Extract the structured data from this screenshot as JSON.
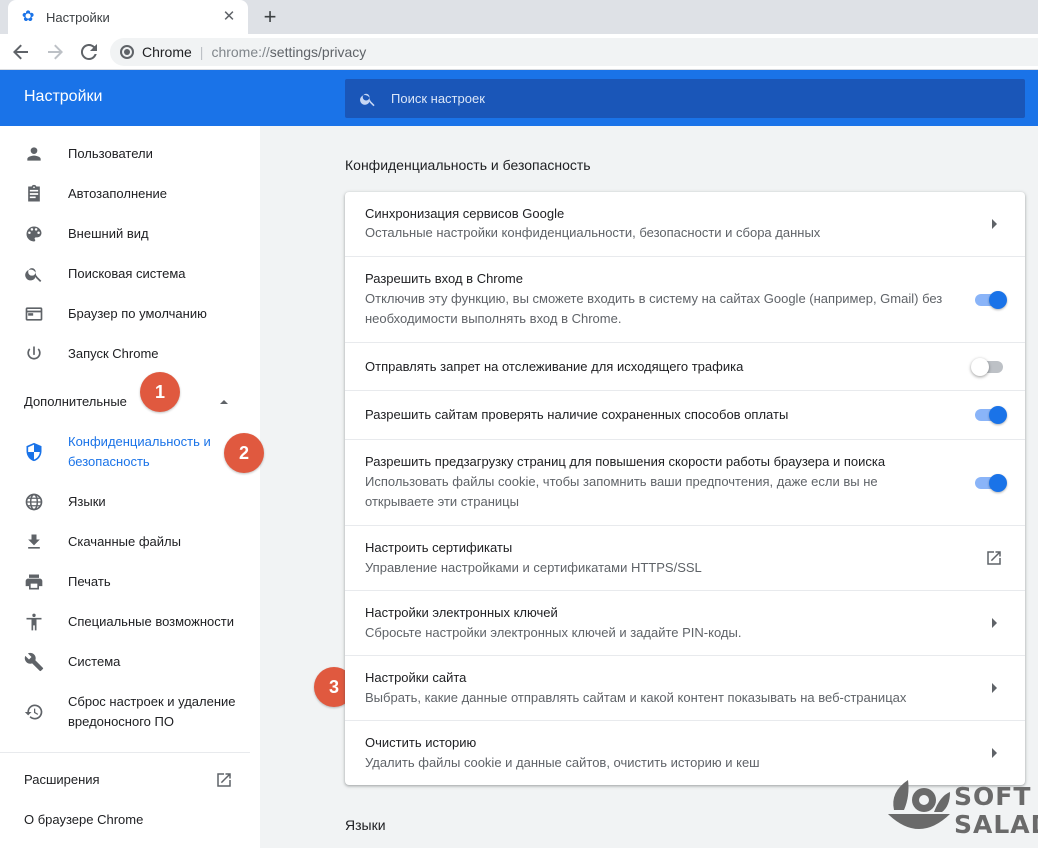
{
  "browser": {
    "tab_title": "Настройки",
    "address_origin": "Chrome",
    "address_scheme": "chrome://",
    "address_rest": "settings/privacy"
  },
  "header": {
    "title": "Настройки",
    "search_placeholder": "Поиск настроек"
  },
  "sidebar": {
    "items": [
      {
        "label": "Пользователи",
        "icon": "person-icon"
      },
      {
        "label": "Автозаполнение",
        "icon": "clipboard-icon"
      },
      {
        "label": "Внешний вид",
        "icon": "palette-icon"
      },
      {
        "label": "Поисковая система",
        "icon": "search-icon"
      },
      {
        "label": "Браузер по умолчанию",
        "icon": "browser-window-icon"
      },
      {
        "label": "Запуск Chrome",
        "icon": "power-icon"
      }
    ],
    "advanced_label": "Дополнительные",
    "advanced_items": [
      {
        "label": "Конфиденциальность и безопасность",
        "icon": "shield-icon",
        "active": true
      },
      {
        "label": "Языки",
        "icon": "globe-icon"
      },
      {
        "label": "Скачанные файлы",
        "icon": "download-icon"
      },
      {
        "label": "Печать",
        "icon": "printer-icon"
      },
      {
        "label": "Специальные возможности",
        "icon": "accessibility-icon"
      },
      {
        "label": "Система",
        "icon": "wrench-icon"
      },
      {
        "label": "Сброс настроек и удаление вредоносного ПО",
        "icon": "restore-icon"
      }
    ],
    "extensions_label": "Расширения",
    "about_label": "О браузере Chrome"
  },
  "badges": [
    "1",
    "2",
    "3"
  ],
  "main": {
    "section_title": "Конфиденциальность и безопасность",
    "next_section_title": "Языки",
    "rows": [
      {
        "title": "Синхронизация сервисов Google",
        "subtitle": "Остальные настройки конфиденциальности, безопасности и сбора данных",
        "control": "arrow"
      },
      {
        "title": "Разрешить вход в Chrome",
        "subtitle": "Отключив эту функцию, вы сможете входить в систему на сайтах Google (например, Gmail) без необходимости выполнять вход в Chrome.",
        "control": "toggle",
        "on": true
      },
      {
        "title": "Отправлять запрет на отслеживание для исходящего трафика",
        "subtitle": "",
        "control": "toggle",
        "on": false
      },
      {
        "title": "Разрешить сайтам проверять наличие сохраненных способов оплаты",
        "subtitle": "",
        "control": "toggle",
        "on": true
      },
      {
        "title": "Разрешить предзагрузку страниц для повышения скорости работы браузера и поиска",
        "subtitle": "Использовать файлы cookie, чтобы запомнить ваши предпочтения, даже если вы не открываете эти страницы",
        "control": "toggle",
        "on": true
      },
      {
        "title": "Настроить сертификаты",
        "subtitle": "Управление настройками и сертификатами HTTPS/SSL",
        "control": "external"
      },
      {
        "title": "Настройки электронных ключей",
        "subtitle": "Сбросьте настройки электронных ключей и задайте PIN-коды.",
        "control": "arrow"
      },
      {
        "title": "Настройки сайта",
        "subtitle": "Выбрать, какие данные отправлять сайтам и какой контент показывать на веб-страницах",
        "control": "arrow"
      },
      {
        "title": "Очистить историю",
        "subtitle": "Удалить файлы cookie и данные сайтов, очистить историю и кеш",
        "control": "arrow"
      }
    ]
  },
  "watermark": {
    "line1": "SOFT",
    "line2": "SALAD"
  },
  "colors": {
    "accent": "#1a73e8",
    "badge": "#e0593f",
    "header": "#1a73e8"
  }
}
